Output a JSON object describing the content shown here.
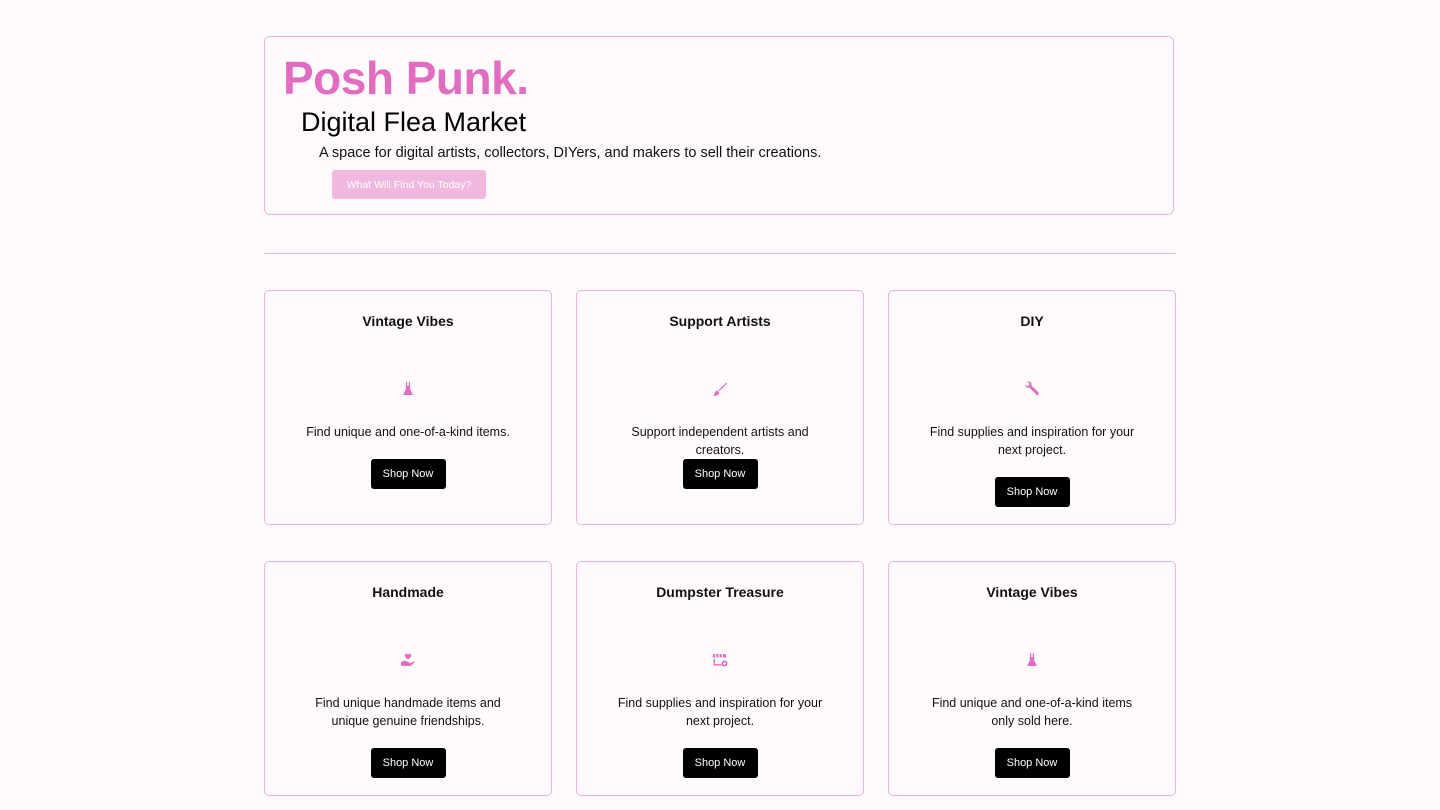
{
  "hero": {
    "brand": "Posh Punk.",
    "subtitle": "Digital Flea Market",
    "tagline": "A space for digital artists, collectors, DIYers, and makers to sell their creations.",
    "cta_label": "What Will Find You Today?"
  },
  "colors": {
    "accent": "#e06dbf",
    "border": "#e7b6db",
    "cta_bg": "#f1b8df",
    "button_bg": "#000000",
    "background": "#fffbfd"
  },
  "cards": [
    {
      "title": "Vintage Vibes",
      "icon": "dress-icon",
      "description": "Find unique and one-of-a-kind items.",
      "button_label": "Shop Now"
    },
    {
      "title": "Support Artists",
      "icon": "paintbrush-icon",
      "description": "Support independent artists and creators.",
      "button_label": "Shop Now"
    },
    {
      "title": "DIY",
      "icon": "wrench-icon",
      "description": "Find supplies and inspiration for your next project.",
      "button_label": "Shop Now"
    },
    {
      "title": "Handmade",
      "icon": "hand-heart-icon",
      "description": "Find unique handmade items and unique genuine friendships.",
      "button_label": "Shop Now"
    },
    {
      "title": "Dumpster Treasure",
      "icon": "storefront-icon",
      "description": "Find supplies and inspiration for your next project.",
      "button_label": "Shop Now"
    },
    {
      "title": "Vintage Vibes",
      "icon": "dress-icon",
      "description": "Find unique and one-of-a-kind items only sold here.",
      "button_label": "Shop Now"
    }
  ]
}
